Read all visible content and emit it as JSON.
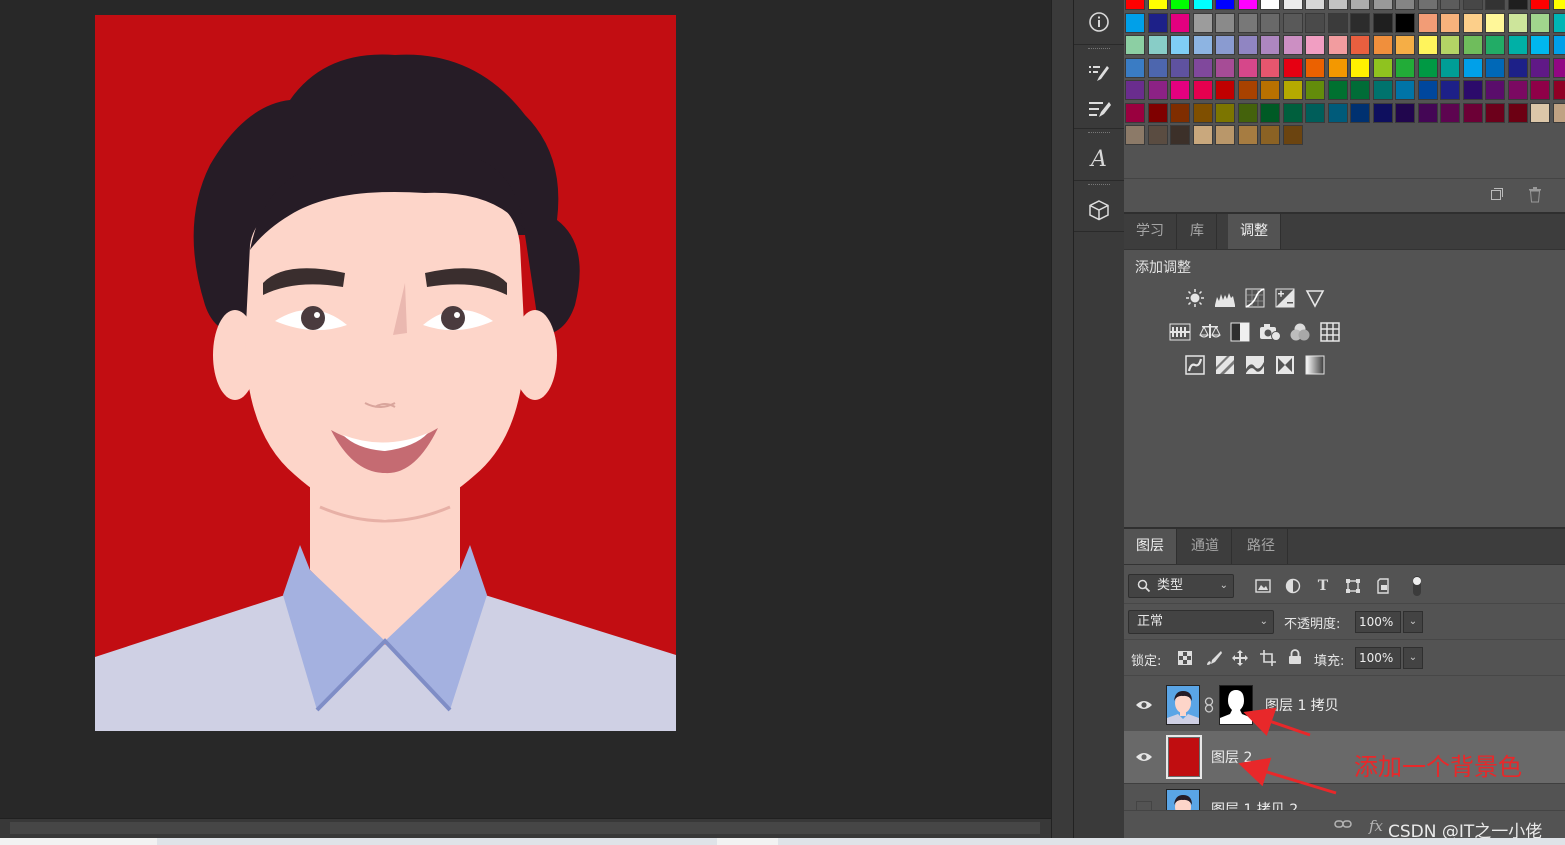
{
  "swatches": {
    "rows": [
      [
        "#ff0000",
        "#ffff00",
        "#00ff00",
        "#00ffff",
        "#0000ff",
        "#ff00ff",
        "#ffffff",
        "#ebebeb",
        "#d6d6d6",
        "#c2c2c2",
        "#adadad",
        "#999999",
        "#858585",
        "#707070",
        "#5c5c5c",
        "#474747",
        "#333333",
        "#1f1f1f",
        "#ff0000",
        "#ffff00"
      ],
      [
        "#00a0e9",
        "#1d2088",
        "#e4007f",
        "#9c9c9c",
        "#8a8a8a",
        "#787878",
        "#696969",
        "#595959",
        "#4a4a4a",
        "#3b3b3b",
        "#2c2c2c",
        "#1f1f1f",
        "#000000",
        "#f29c76",
        "#f7b27c",
        "#fccf8a",
        "#fff799",
        "#cde59b",
        "#a1d58d",
        "#00b5b5"
      ],
      [
        "#8ccfa3",
        "#88cdc7",
        "#7fcdf5",
        "#8db4e2",
        "#8a9bd0",
        "#9085c2",
        "#ad86c0",
        "#cc8fc3",
        "#f19ec2",
        "#f29c9f",
        "#e95f3f",
        "#f08f3c",
        "#f5ae46",
        "#fff45c",
        "#b3d465",
        "#6fbd5c",
        "#22ac66",
        "#00b0a6",
        "#00b7ee",
        "#00a0e9"
      ],
      [
        "#3a7cc4",
        "#4d66ae",
        "#5f52a0",
        "#80489c",
        "#a64c96",
        "#d6478a",
        "#e6566e",
        "#e60012",
        "#eb6100",
        "#f39800",
        "#fff100",
        "#8fc31f",
        "#22ac38",
        "#009944",
        "#009e96",
        "#00a0e9",
        "#0068b7",
        "#1d2088",
        "#601986",
        "#920783"
      ],
      [
        "#6a2d8e",
        "#8c2285",
        "#e4007f",
        "#e5004f",
        "#c00000",
        "#a84200",
        "#b97100",
        "#b5aa00",
        "#638c0b",
        "#007130",
        "#006c37",
        "#00736d",
        "#0074a7",
        "#00479d",
        "#1d2088",
        "#2c0b6b",
        "#5a0d6b",
        "#7b0962",
        "#8f0048",
        "#8f0025"
      ],
      [
        "#9a003f",
        "#7f0000",
        "#7f2d00",
        "#7f4f00",
        "#7c7500",
        "#44620c",
        "#005a25",
        "#005f3d",
        "#005e5a",
        "#005b7a",
        "#003170",
        "#0e0f5e",
        "#21064d",
        "#440655",
        "#5d0550",
        "#6c0036",
        "#6c001b",
        "#6c0013",
        "#dcc7a9",
        "#c0a283"
      ],
      [
        "#8c7a68",
        "#5a4c41",
        "#3c3029",
        "#c9a87d",
        "#b9976a",
        "#a67c41",
        "#8b6224",
        "#6b4410"
      ]
    ]
  },
  "adjustments_panel": {
    "tabs": [
      "学习",
      "库",
      "调整"
    ],
    "active_tab": "调整",
    "title": "添加调整"
  },
  "layers_panel": {
    "tabs": [
      "图层",
      "通道",
      "路径"
    ],
    "active_tab": "图层",
    "filter_label": "类型",
    "blend_mode": "正常",
    "opacity_label": "不透明度:",
    "opacity_value": "100%",
    "lock_label": "锁定:",
    "fill_label": "填充:",
    "fill_value": "100%",
    "layers": [
      {
        "name": "图层 1 拷贝",
        "visible": true,
        "has_mask": true
      },
      {
        "name": "图层 2",
        "visible": true,
        "selected": true,
        "fill_color": "#c00d10"
      },
      {
        "name": "图层 1 拷贝 2",
        "visible": false
      }
    ],
    "annotation": "添加一个背景色",
    "annotation_color": "#e8282a",
    "footer_fx": "fx",
    "watermark": "CSDN @IT之一小佬"
  },
  "colors": {
    "canvas_bg": "#282828",
    "panel_bg": "#535353",
    "portrait_bg": "#c20d12",
    "hair": "#261c26",
    "skin": "#fdd5c9",
    "collar": "#a4b1e0",
    "shirt": "#cfd0e4"
  }
}
